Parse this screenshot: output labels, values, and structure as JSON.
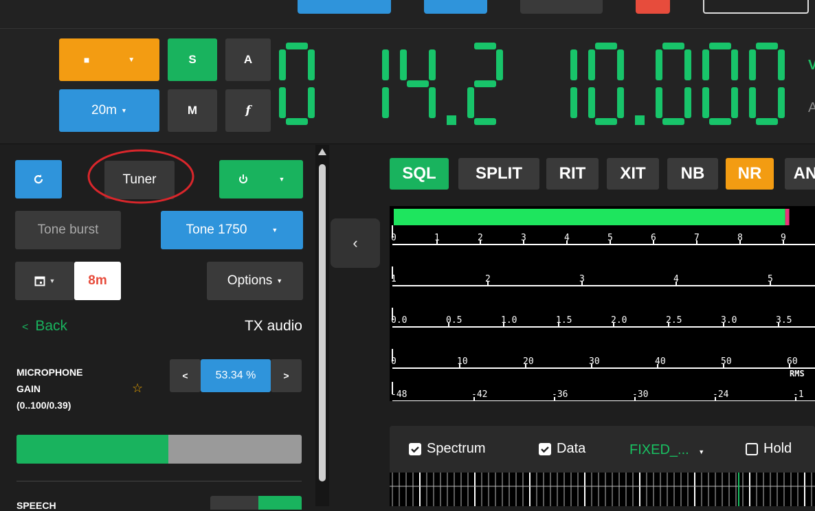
{
  "header": {
    "mode_stop_glyph": "■",
    "band": "20m",
    "vfo_buttons": [
      "S",
      "A",
      "M",
      "f"
    ],
    "frequency": "0 14.2 10.000",
    "vfo_suffix_top": "V",
    "vfo_suffix_bottom": "A"
  },
  "left_panel": {
    "refresh_icon": "refresh-icon",
    "tuner_label": "Tuner",
    "power_icon": "power-icon",
    "tone_burst_label": "Tone burst",
    "tone_select_label": "Tone 1750",
    "calendar_icon": "calendar-icon",
    "band_8m_label": "8m",
    "options_label": "Options",
    "back_label": "Back",
    "section_title": "TX audio",
    "mic_gain_label_1": "MICROPHONE",
    "mic_gain_label_2": "GAIN",
    "mic_gain_range": "(0..100/0.39)",
    "mic_gain_value": "53.34 %",
    "mic_gain_fill": 0.5334,
    "dec_label": "<",
    "inc_label": ">",
    "speech_label": "SPEECH"
  },
  "right_panel": {
    "tags": [
      {
        "label": "SQL",
        "color": "#19b35e"
      },
      {
        "label": "SPLIT",
        "color": "#3a3a3a"
      },
      {
        "label": "RIT",
        "color": "#3a3a3a"
      },
      {
        "label": "XIT",
        "color": "#3a3a3a"
      },
      {
        "label": "NB",
        "color": "#3a3a3a"
      },
      {
        "label": "NR",
        "color": "#f39c12"
      },
      {
        "label": "AN",
        "color": "#3a3a3a"
      }
    ],
    "meter_level_fraction": 0.93,
    "scales": [
      [
        "0",
        "1",
        "2",
        "3",
        "4",
        "5",
        "6",
        "7",
        "8",
        "9"
      ],
      [
        "1",
        "2",
        "3",
        "4",
        "5"
      ],
      [
        "0.0",
        "0.5",
        "1.0",
        "1.5",
        "2.0",
        "2.5",
        "3.0",
        "3.5"
      ],
      [
        "0",
        "10",
        "20",
        "30",
        "40",
        "50",
        "60"
      ],
      [
        "-48",
        "-42",
        "-36",
        "-30",
        "-24",
        "-1"
      ]
    ],
    "rms_label": "RMS",
    "spectrum_label": "Spectrum",
    "data_label": "Data",
    "fixed_label": "FIXED_...",
    "hold_label": "Hold"
  }
}
